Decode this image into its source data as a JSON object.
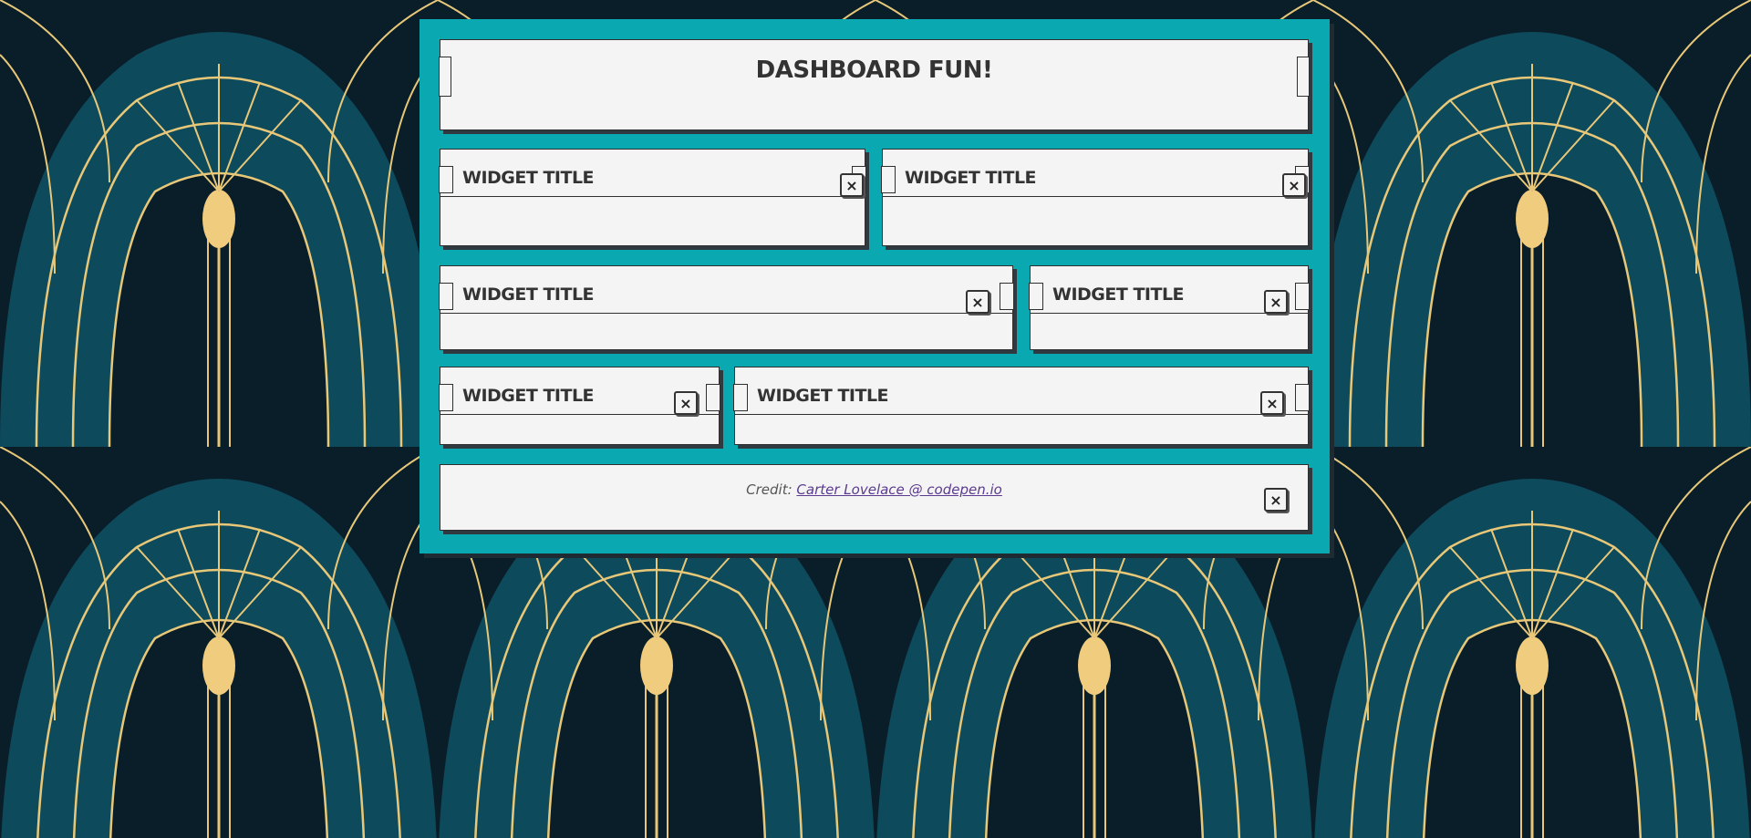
{
  "header": {
    "title": "DASHBOARD FUN!"
  },
  "widgets": [
    {
      "title": "WIDGET TITLE",
      "close": "×"
    },
    {
      "title": "WIDGET TITLE",
      "close": "×"
    },
    {
      "title": "WIDGET TITLE",
      "close": "×"
    },
    {
      "title": "WIDGET TITLE",
      "close": "×"
    },
    {
      "title": "WIDGET TITLE",
      "close": "×"
    },
    {
      "title": "WIDGET TITLE",
      "close": "×"
    }
  ],
  "footer": {
    "credit_prefix": "Credit:",
    "credit_link": "Carter Lovelace @ codepen.io",
    "close": "×"
  },
  "colors": {
    "dashboard": "#0aa9b2",
    "panel": "#f4f4f4",
    "background_dark": "#0a1e2a",
    "background_teal": "#0d4a5c",
    "accent_gold": "#e8c878"
  }
}
